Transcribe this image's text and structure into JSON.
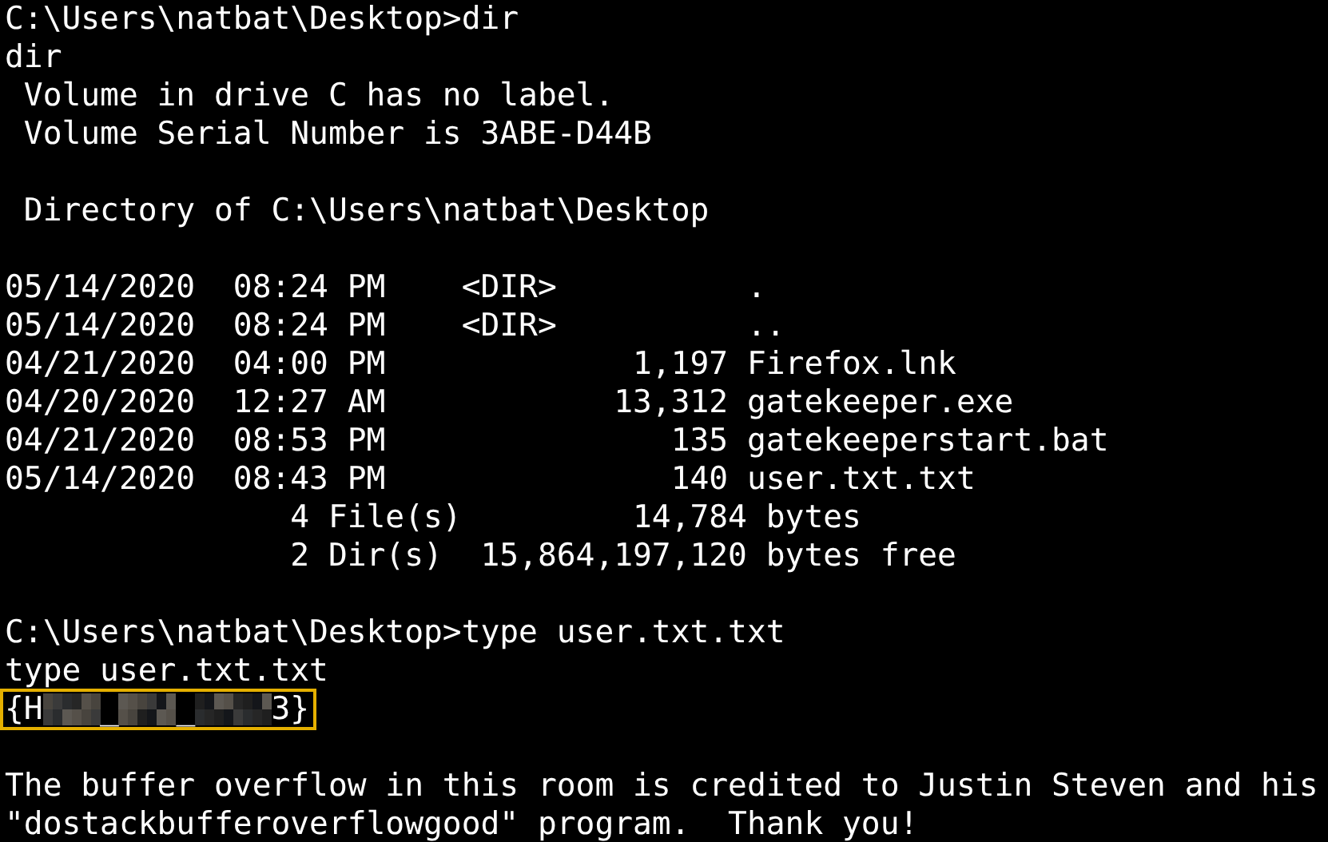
{
  "terminal": {
    "lines": [
      {
        "kind": "text",
        "text": "C:\\Users\\natbat\\Desktop>dir"
      },
      {
        "kind": "text",
        "text": "dir"
      },
      {
        "kind": "text",
        "text": " Volume in drive C has no label."
      },
      {
        "kind": "text",
        "text": " Volume Serial Number is 3ABE-D44B"
      },
      {
        "kind": "blank"
      },
      {
        "kind": "text",
        "text": " Directory of C:\\Users\\natbat\\Desktop"
      },
      {
        "kind": "blank"
      },
      {
        "kind": "text",
        "text": "05/14/2020  08:24 PM    <DIR>          ."
      },
      {
        "kind": "text",
        "text": "05/14/2020  08:24 PM    <DIR>          .."
      },
      {
        "kind": "text",
        "text": "04/21/2020  04:00 PM             1,197 Firefox.lnk"
      },
      {
        "kind": "text",
        "text": "04/20/2020  12:27 AM            13,312 gatekeeper.exe"
      },
      {
        "kind": "text",
        "text": "04/21/2020  08:53 PM               135 gatekeeperstart.bat"
      },
      {
        "kind": "text",
        "text": "05/14/2020  08:43 PM               140 user.txt.txt"
      },
      {
        "kind": "text",
        "text": "               4 File(s)         14,784 bytes"
      },
      {
        "kind": "text",
        "text": "               2 Dir(s)  15,864,197,120 bytes free"
      },
      {
        "kind": "blank"
      },
      {
        "kind": "text",
        "text": "C:\\Users\\natbat\\Desktop>type user.txt.txt"
      },
      {
        "kind": "text",
        "text": "type user.txt.txt"
      },
      {
        "kind": "flag",
        "segments": [
          {
            "kind": "text",
            "text": "{H"
          },
          {
            "kind": "redacted"
          },
          {
            "kind": "text",
            "text": "_"
          },
          {
            "kind": "redacted"
          },
          {
            "kind": "text",
            "text": "_"
          },
          {
            "kind": "redacted"
          },
          {
            "kind": "text",
            "text": "3}"
          }
        ]
      },
      {
        "kind": "blank"
      },
      {
        "kind": "text",
        "text": "The buffer overflow in this room is credited to Justin Steven and his"
      },
      {
        "kind": "text",
        "text": "\"dostackbufferoverflowgood\" program.  Thank you!"
      }
    ]
  }
}
